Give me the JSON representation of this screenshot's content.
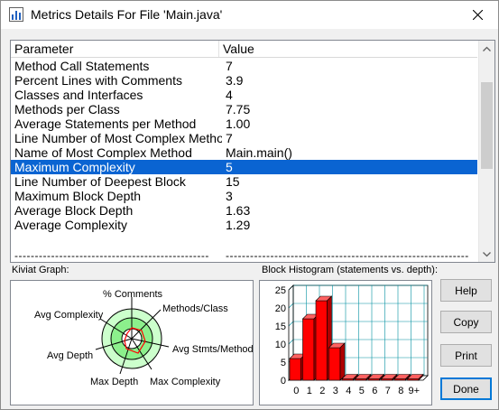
{
  "window": {
    "title": "Metrics Details For File 'Main.java'"
  },
  "table": {
    "columns": [
      "Parameter",
      "Value"
    ],
    "rows": [
      {
        "parameter": "Method Call Statements",
        "value": "7"
      },
      {
        "parameter": "Percent Lines with Comments",
        "value": "3.9"
      },
      {
        "parameter": "Classes and Interfaces",
        "value": "4"
      },
      {
        "parameter": "Methods per Class",
        "value": "7.75"
      },
      {
        "parameter": "Average Statements per Method",
        "value": "1.00"
      },
      {
        "parameter": "Line Number of Most Complex Method",
        "value": "7"
      },
      {
        "parameter": "Name of Most Complex Method",
        "value": "Main.main()"
      },
      {
        "parameter": "Maximum Complexity",
        "value": "5"
      },
      {
        "parameter": "Line Number of Deepest Block",
        "value": "15"
      },
      {
        "parameter": "Maximum Block Depth",
        "value": "3"
      },
      {
        "parameter": "Average Block Depth",
        "value": "1.63"
      },
      {
        "parameter": "Average Complexity",
        "value": "1.29"
      }
    ],
    "selected_row": 7,
    "separator_left": "------------------------------------------------",
    "separator_right": "------------------------------------------------------------"
  },
  "kiviat": {
    "label": "Kiviat Graph:",
    "axes": [
      "% Comments",
      "Methods/Class",
      "Avg Stmts/Method",
      "Max Complexity",
      "Max Depth",
      "Avg Depth",
      "Avg Complexity"
    ]
  },
  "histogram": {
    "label": "Block Histogram (statements vs. depth):",
    "y_ticks": [
      "25",
      "20",
      "15",
      "10",
      "5",
      "0"
    ],
    "x_labels": [
      "0",
      "1",
      "2",
      "3",
      "4",
      "5",
      "6",
      "7",
      "8",
      "9+"
    ]
  },
  "chart_data": {
    "type": "bar",
    "title": "Block Histogram (statements vs. depth):",
    "categories": [
      "0",
      "1",
      "2",
      "3",
      "4",
      "5",
      "6",
      "7",
      "8",
      "9+"
    ],
    "values": [
      6,
      17,
      22,
      9,
      0,
      0,
      0,
      0,
      0,
      0
    ],
    "ylim": [
      0,
      25
    ],
    "bar_color": "#ff0000"
  },
  "buttons": {
    "help": "Help",
    "copy": "Copy",
    "print": "Print",
    "done": "Done"
  },
  "colors": {
    "selection": "#0a64d2",
    "kiviat_ring": "#8cf08c",
    "bar": "#ff0000"
  }
}
